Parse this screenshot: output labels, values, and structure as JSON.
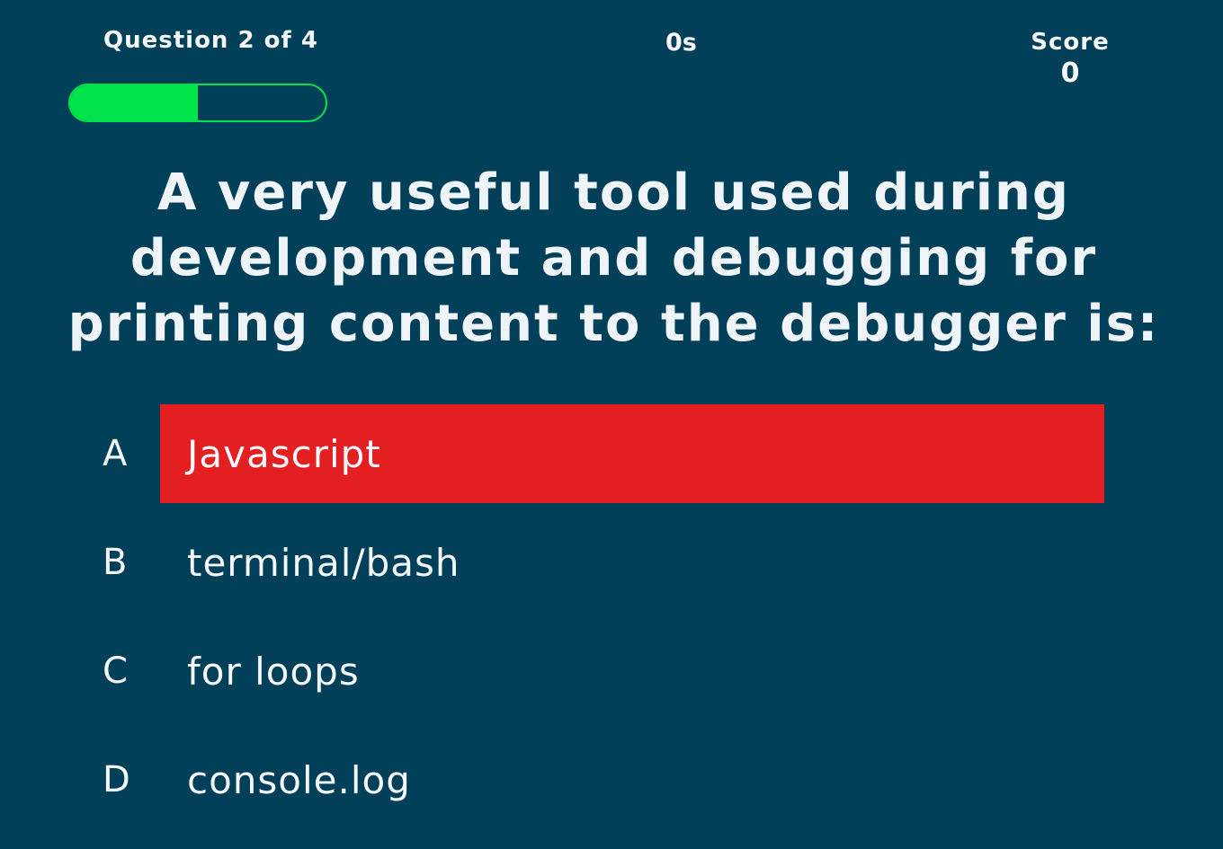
{
  "hud": {
    "progress_text": "Question 2 of 4",
    "progress_fraction": 0.5,
    "timer": "0s",
    "score_label": "Score",
    "score_value": "0"
  },
  "question": {
    "text": "A very useful tool used during development and debugging for printing content to the debugger is:"
  },
  "choices": [
    {
      "letter": "A",
      "text": "Javascript",
      "selected": true
    },
    {
      "letter": "B",
      "text": "terminal/bash",
      "selected": false
    },
    {
      "letter": "C",
      "text": "for loops",
      "selected": false
    },
    {
      "letter": "D",
      "text": "console.log",
      "selected": false
    }
  ],
  "colors": {
    "background": "#023f58",
    "progress_fill": "#00e34a",
    "selected_choice": "#e31f22",
    "text": "#f4f8fb"
  }
}
